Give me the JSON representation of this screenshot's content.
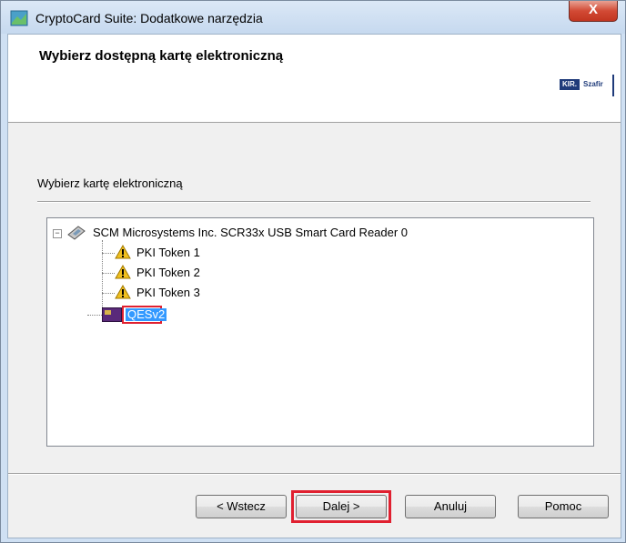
{
  "window": {
    "title": "CryptoCard Suite: Dodatkowe narzędzia",
    "close_label": "X"
  },
  "header": {
    "title": "Wybierz dostępną kartę elektroniczną",
    "logo_kir": "KIR.",
    "logo_szafir": "Szafir"
  },
  "section": {
    "label": "Wybierz kartę elektroniczną"
  },
  "tree": {
    "reader": "SCM Microsystems Inc. SCR33x USB Smart Card Reader 0",
    "tokens": [
      "PKI Token 1",
      "PKI Token 2",
      "PKI Token 3"
    ],
    "selected": "QESv2"
  },
  "buttons": {
    "back": "< Wstecz",
    "next": "Dalej >",
    "cancel": "Anuluj",
    "help": "Pomoc"
  },
  "colors": {
    "selection": "#3399ff",
    "highlight": "#e02030"
  }
}
